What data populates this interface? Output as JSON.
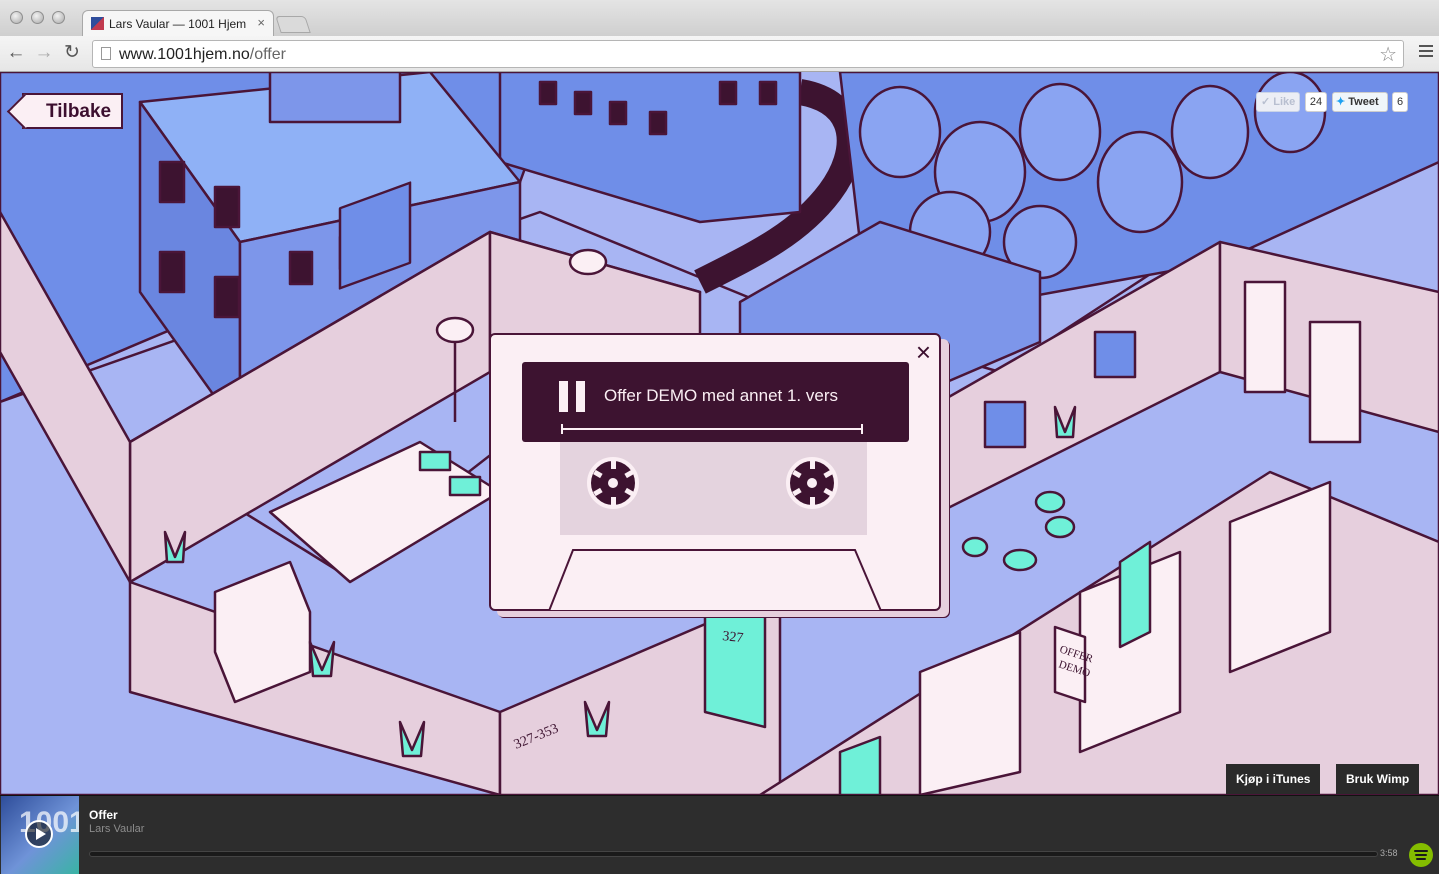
{
  "browser": {
    "tab_title": "Lars Vaular — 1001 Hjem",
    "tab_close": "×",
    "url_domain": "www.1001hjem.no",
    "url_path": "/offer"
  },
  "page": {
    "back_label": "Tilbake",
    "like_label": "Like",
    "like_count": "24",
    "tweet_label": "Tweet",
    "tweet_count": "6",
    "buy_itunes": "Kjøp i iTunes",
    "use_wimp": "Bruk Wimp"
  },
  "modal": {
    "close": "×",
    "track_title": "Offer DEMO med annet 1. vers",
    "progress": 0
  },
  "player": {
    "title": "Offer",
    "artist": "Lars Vaular",
    "duration": "3:58",
    "cover_text": "1001",
    "progress": 0
  },
  "colors": {
    "ink": "#4a1538",
    "paper": "#fbeff4",
    "wall": "#e6cfdd",
    "sky_blue": "#6f8ee8",
    "floor": "#a8b5f3",
    "mint": "#6ff0d8",
    "spotify": "#84bd00"
  },
  "icons": [
    "back-arrow-icon",
    "forward-arrow-icon",
    "reload-icon",
    "page-icon",
    "bookmark-star-icon",
    "menu-icon",
    "close-icon",
    "pause-icon",
    "play-icon",
    "twitter-bird-icon",
    "spotify-icon"
  ]
}
